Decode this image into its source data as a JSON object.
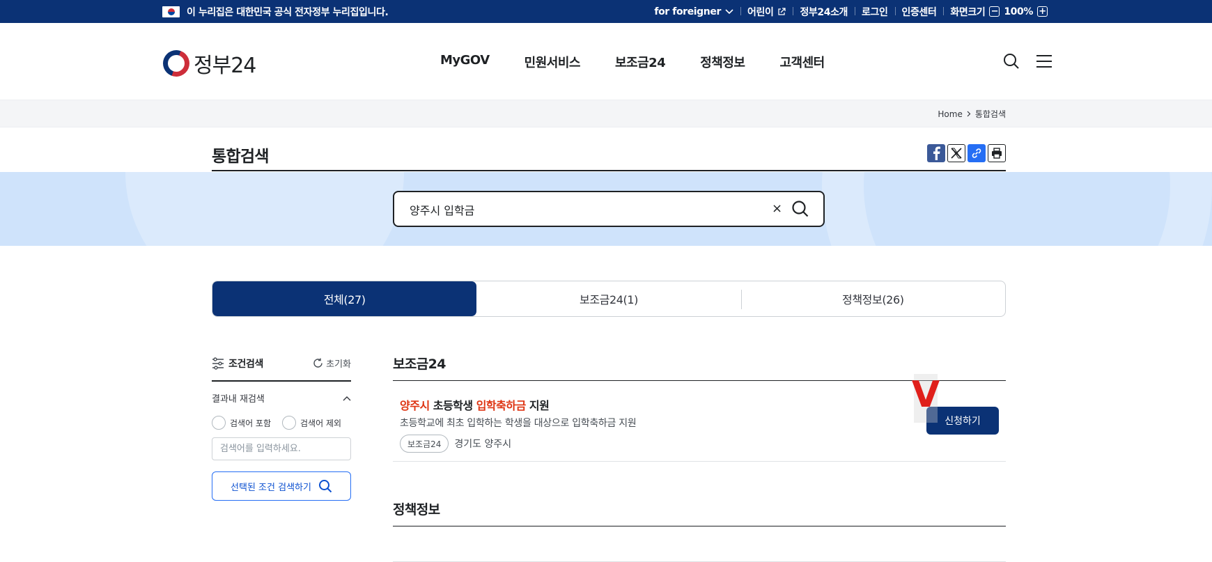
{
  "gov_bar": {
    "notice": "이 누리집은 대한민국 공식 전자정부 누리집입니다.",
    "links": [
      "for foreigner",
      "어린이",
      "정부24소개",
      "로그인",
      "인증센터",
      "화면크기"
    ],
    "zoom_level": "100%",
    "zoom_minus": "−",
    "zoom_plus": "+"
  },
  "header": {
    "logo_text": "정부24",
    "nav": [
      "MyGOV",
      "민원서비스",
      "보조금24",
      "정책정보",
      "고객센터"
    ]
  },
  "breadcrumb": {
    "home": "Home",
    "current": "통합검색"
  },
  "page": {
    "title": "통합검색"
  },
  "search": {
    "query": "양주시 입학금",
    "clear": "×"
  },
  "tabs": [
    {
      "label": "전체(27)",
      "active": true
    },
    {
      "label": "보조금24(1)",
      "active": false
    },
    {
      "label": "정책정보(26)",
      "active": false
    }
  ],
  "filter": {
    "title": "조건검색",
    "reset": "초기화",
    "within_label": "결과내 재검색",
    "include_label": "검색어 포함",
    "exclude_label": "검색어 제외",
    "keyword_placeholder": "검색어를 입력하세요.",
    "apply_label": "선택된 조건 검색하기"
  },
  "results": {
    "section_title": "보조금24",
    "items": [
      {
        "name_hl1": "양주시",
        "name_mid": " 초등학생 ",
        "name_hl2": "입학축하금",
        "name_end": " 지원",
        "desc": "초등학교에 최초 입학하는 학생을 대상으로 입학축하금 지원",
        "badge": "보조금24",
        "region": "경기도 양주시",
        "apply_label": "신청하기"
      }
    ],
    "overlay_mark": "V",
    "section2_title": "정책정보"
  },
  "colors": {
    "navy": "#0b3275",
    "highlight": "#de3412",
    "band": "#cfe3fb"
  }
}
